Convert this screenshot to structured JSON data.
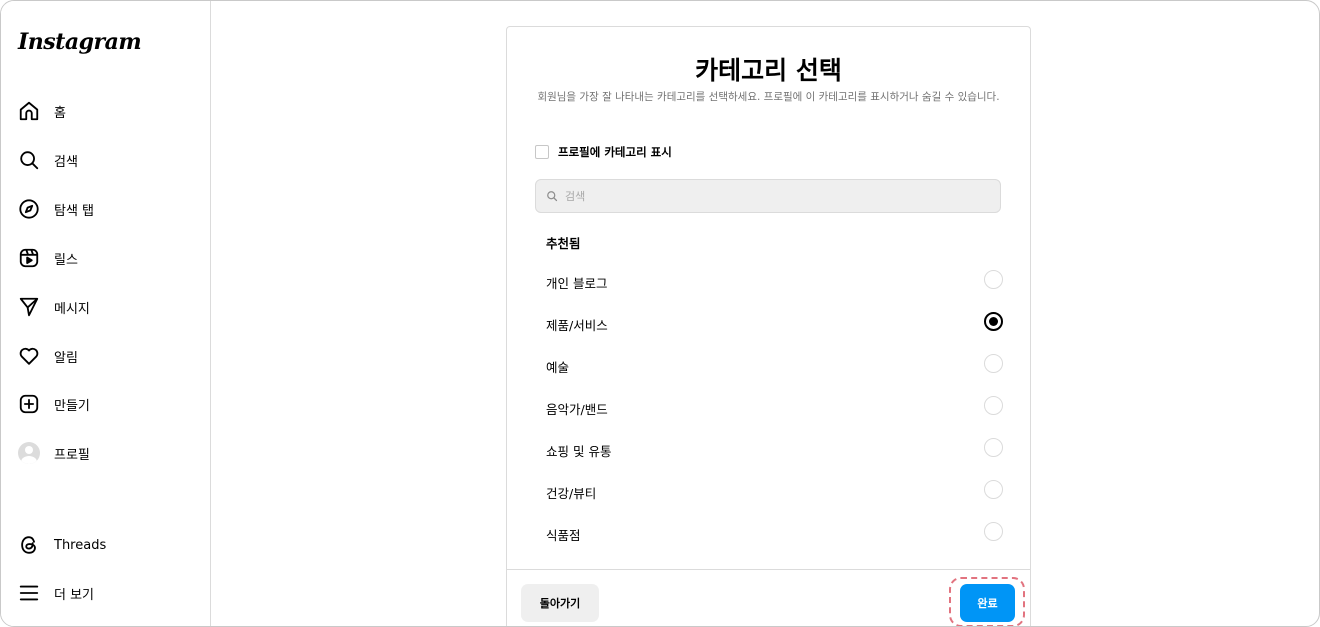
{
  "sidebar": {
    "logo": "Instagram",
    "items": [
      {
        "label": "홈",
        "icon": "home-icon"
      },
      {
        "label": "검색",
        "icon": "search-icon"
      },
      {
        "label": "탐색 탭",
        "icon": "compass-icon"
      },
      {
        "label": "릴스",
        "icon": "reels-icon"
      },
      {
        "label": "메시지",
        "icon": "send-icon"
      },
      {
        "label": "알림",
        "icon": "heart-icon"
      },
      {
        "label": "만들기",
        "icon": "plus-square-icon"
      },
      {
        "label": "프로필",
        "icon": "avatar"
      }
    ],
    "bottom": [
      {
        "label": "Threads",
        "icon": "threads-icon"
      },
      {
        "label": "더 보기",
        "icon": "menu-icon"
      }
    ]
  },
  "panel": {
    "title": "카테고리 선택",
    "description": "회원님을 가장 잘 나타내는 카테고리를 선택하세요. 프로필에 이 카테고리를 표시하거나 숨길 수 있습니다.",
    "show_category_label": "프로필에 카테고리 표시",
    "show_category_checked": false,
    "search_placeholder": "검색",
    "section_title": "추천됨",
    "categories": [
      {
        "label": "개인 블로그",
        "selected": false
      },
      {
        "label": "제품/서비스",
        "selected": true
      },
      {
        "label": "예술",
        "selected": false
      },
      {
        "label": "음악가/밴드",
        "selected": false
      },
      {
        "label": "쇼핑 및 유통",
        "selected": false
      },
      {
        "label": "건강/뷰티",
        "selected": false
      },
      {
        "label": "식품점",
        "selected": false
      }
    ],
    "back_label": "돌아가기",
    "done_label": "완료"
  },
  "colors": {
    "accent": "#0095f6",
    "highlight": "#e2737f"
  }
}
